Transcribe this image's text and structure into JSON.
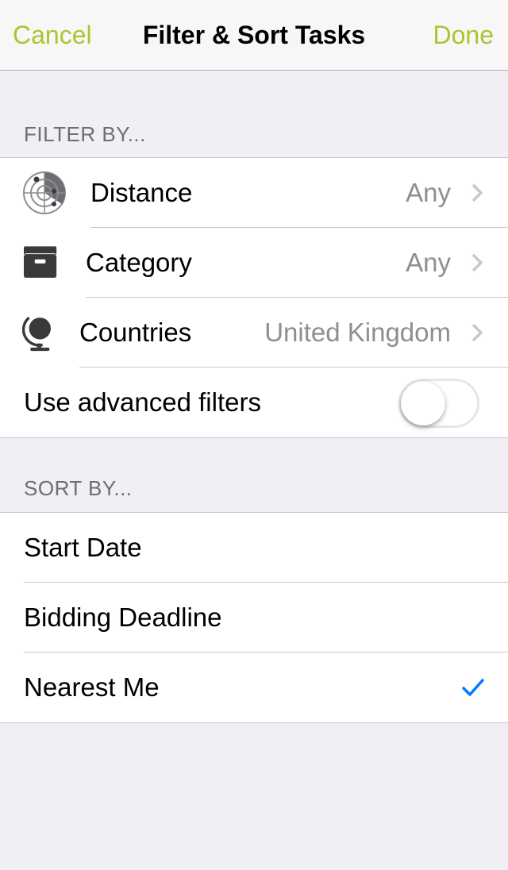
{
  "navbar": {
    "cancel_label": "Cancel",
    "title": "Filter & Sort Tasks",
    "done_label": "Done"
  },
  "filter": {
    "header": "FILTER BY...",
    "rows": [
      {
        "label": "Distance",
        "value": "Any",
        "icon": "radar-icon"
      },
      {
        "label": "Category",
        "value": "Any",
        "icon": "archive-box-icon"
      },
      {
        "label": "Countries",
        "value": "United Kingdom",
        "icon": "globe-icon"
      }
    ],
    "advanced_label": "Use advanced filters",
    "advanced_enabled": false
  },
  "sort": {
    "header": "SORT BY...",
    "options": [
      {
        "label": "Start Date",
        "selected": false
      },
      {
        "label": "Bidding Deadline",
        "selected": false
      },
      {
        "label": "Nearest Me",
        "selected": true
      }
    ]
  },
  "colors": {
    "accent": "#a9c52f",
    "checkmark": "#007aff",
    "background": "#efeff4"
  }
}
